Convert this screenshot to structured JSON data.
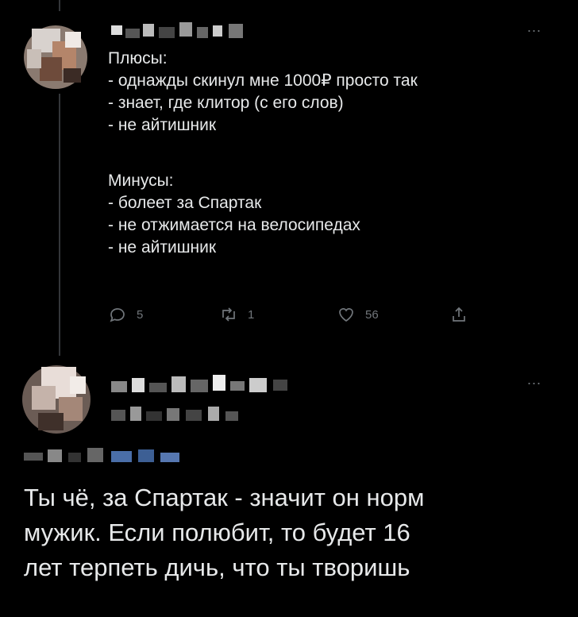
{
  "tweet1": {
    "lines": [
      "Плюсы:",
      "- однажды скинул мне 1000₽ просто так",
      "- знает, где клитор (с его слов)",
      "- не айтишник",
      "Минусы:",
      "- болеет за Спартак",
      "- не отжимается на велосипедах",
      "- не айтишник"
    ],
    "more_label": "...",
    "actions": {
      "replies": "5",
      "retweets": "1",
      "likes": "56"
    }
  },
  "tweet2": {
    "more_label": "...",
    "lines": [
      "Ты чё, за Спартак - значит он норм",
      "мужик. Если полюбит, то будет 16",
      "лет терпеть дичь, что ты творишь"
    ]
  },
  "icons": [
    "reply-icon",
    "retweet-icon",
    "like-icon",
    "share-icon"
  ],
  "colors": {
    "background": "#000000",
    "text": "#e7e9ea",
    "muted": "#71767b",
    "thread_line": "#333639"
  }
}
